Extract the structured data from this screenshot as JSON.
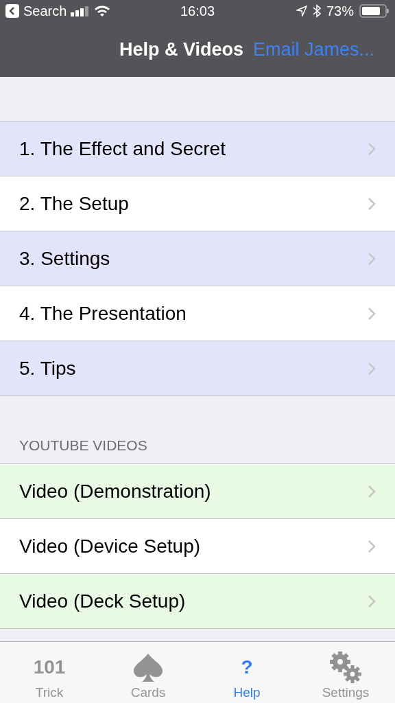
{
  "status_bar": {
    "back_label": "Search",
    "time": "16:03",
    "battery": "73%"
  },
  "nav": {
    "title": "Help & Videos",
    "action": "Email James..."
  },
  "sections": [
    {
      "rows": [
        {
          "label": "1. The Effect and Secret",
          "color": "#e3e3fa"
        },
        {
          "label": "2. The Setup",
          "color": "#ffffff"
        },
        {
          "label": "3. Settings",
          "color": "#e3e3fa"
        },
        {
          "label": "4. The Presentation",
          "color": "#ffffff"
        },
        {
          "label": "5. Tips",
          "color": "#e3e3fa"
        }
      ]
    },
    {
      "header": "YOUTUBE VIDEOS",
      "rows": [
        {
          "label": "Video (Demonstration)",
          "color": "#e8fae3"
        },
        {
          "label": "Video (Device Setup)",
          "color": "#ffffff"
        },
        {
          "label": "Video (Deck Setup)",
          "color": "#e8fae3"
        }
      ]
    }
  ],
  "tabs": [
    {
      "label": "Trick",
      "kind": "glyph",
      "glyph": "101",
      "selected": false
    },
    {
      "label": "Cards",
      "kind": "spade",
      "selected": false
    },
    {
      "label": "Help",
      "kind": "glyph",
      "glyph": "?",
      "selected": true
    },
    {
      "label": "Settings",
      "kind": "gears",
      "selected": false
    }
  ]
}
